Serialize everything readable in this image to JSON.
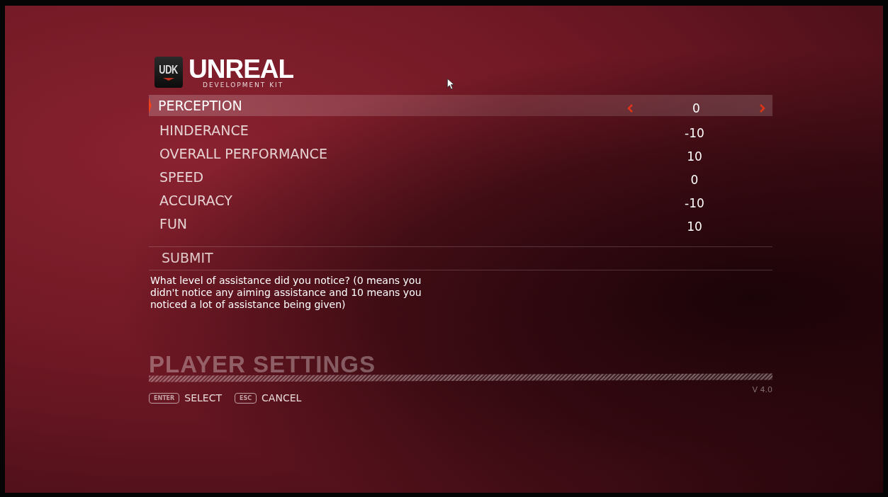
{
  "logo": {
    "badge": "UDK",
    "title": "UNREAL",
    "subtitle": "DEVELOPMENT KIT"
  },
  "options": [
    {
      "label": "PERCEPTION",
      "value": "0",
      "selected": true
    },
    {
      "label": "HINDERANCE",
      "value": "-10",
      "selected": false
    },
    {
      "label": "OVERALL PERFORMANCE",
      "value": "10",
      "selected": false
    },
    {
      "label": "SPEED",
      "value": "0",
      "selected": false
    },
    {
      "label": "ACCURACY",
      "value": "-10",
      "selected": false
    },
    {
      "label": "FUN",
      "value": "10",
      "selected": false
    }
  ],
  "submit": {
    "label": "SUBMIT"
  },
  "description": "What level of assistance did you notice? (0 means you didn't notice any aiming assistance and 10 means you noticed a lot of assistance being given)",
  "section_title": "PLAYER SETTINGS",
  "version": "V 4.0",
  "hints": [
    {
      "key": "ENTER",
      "label": "SELECT"
    },
    {
      "key": "ESC",
      "label": "CANCEL"
    }
  ]
}
